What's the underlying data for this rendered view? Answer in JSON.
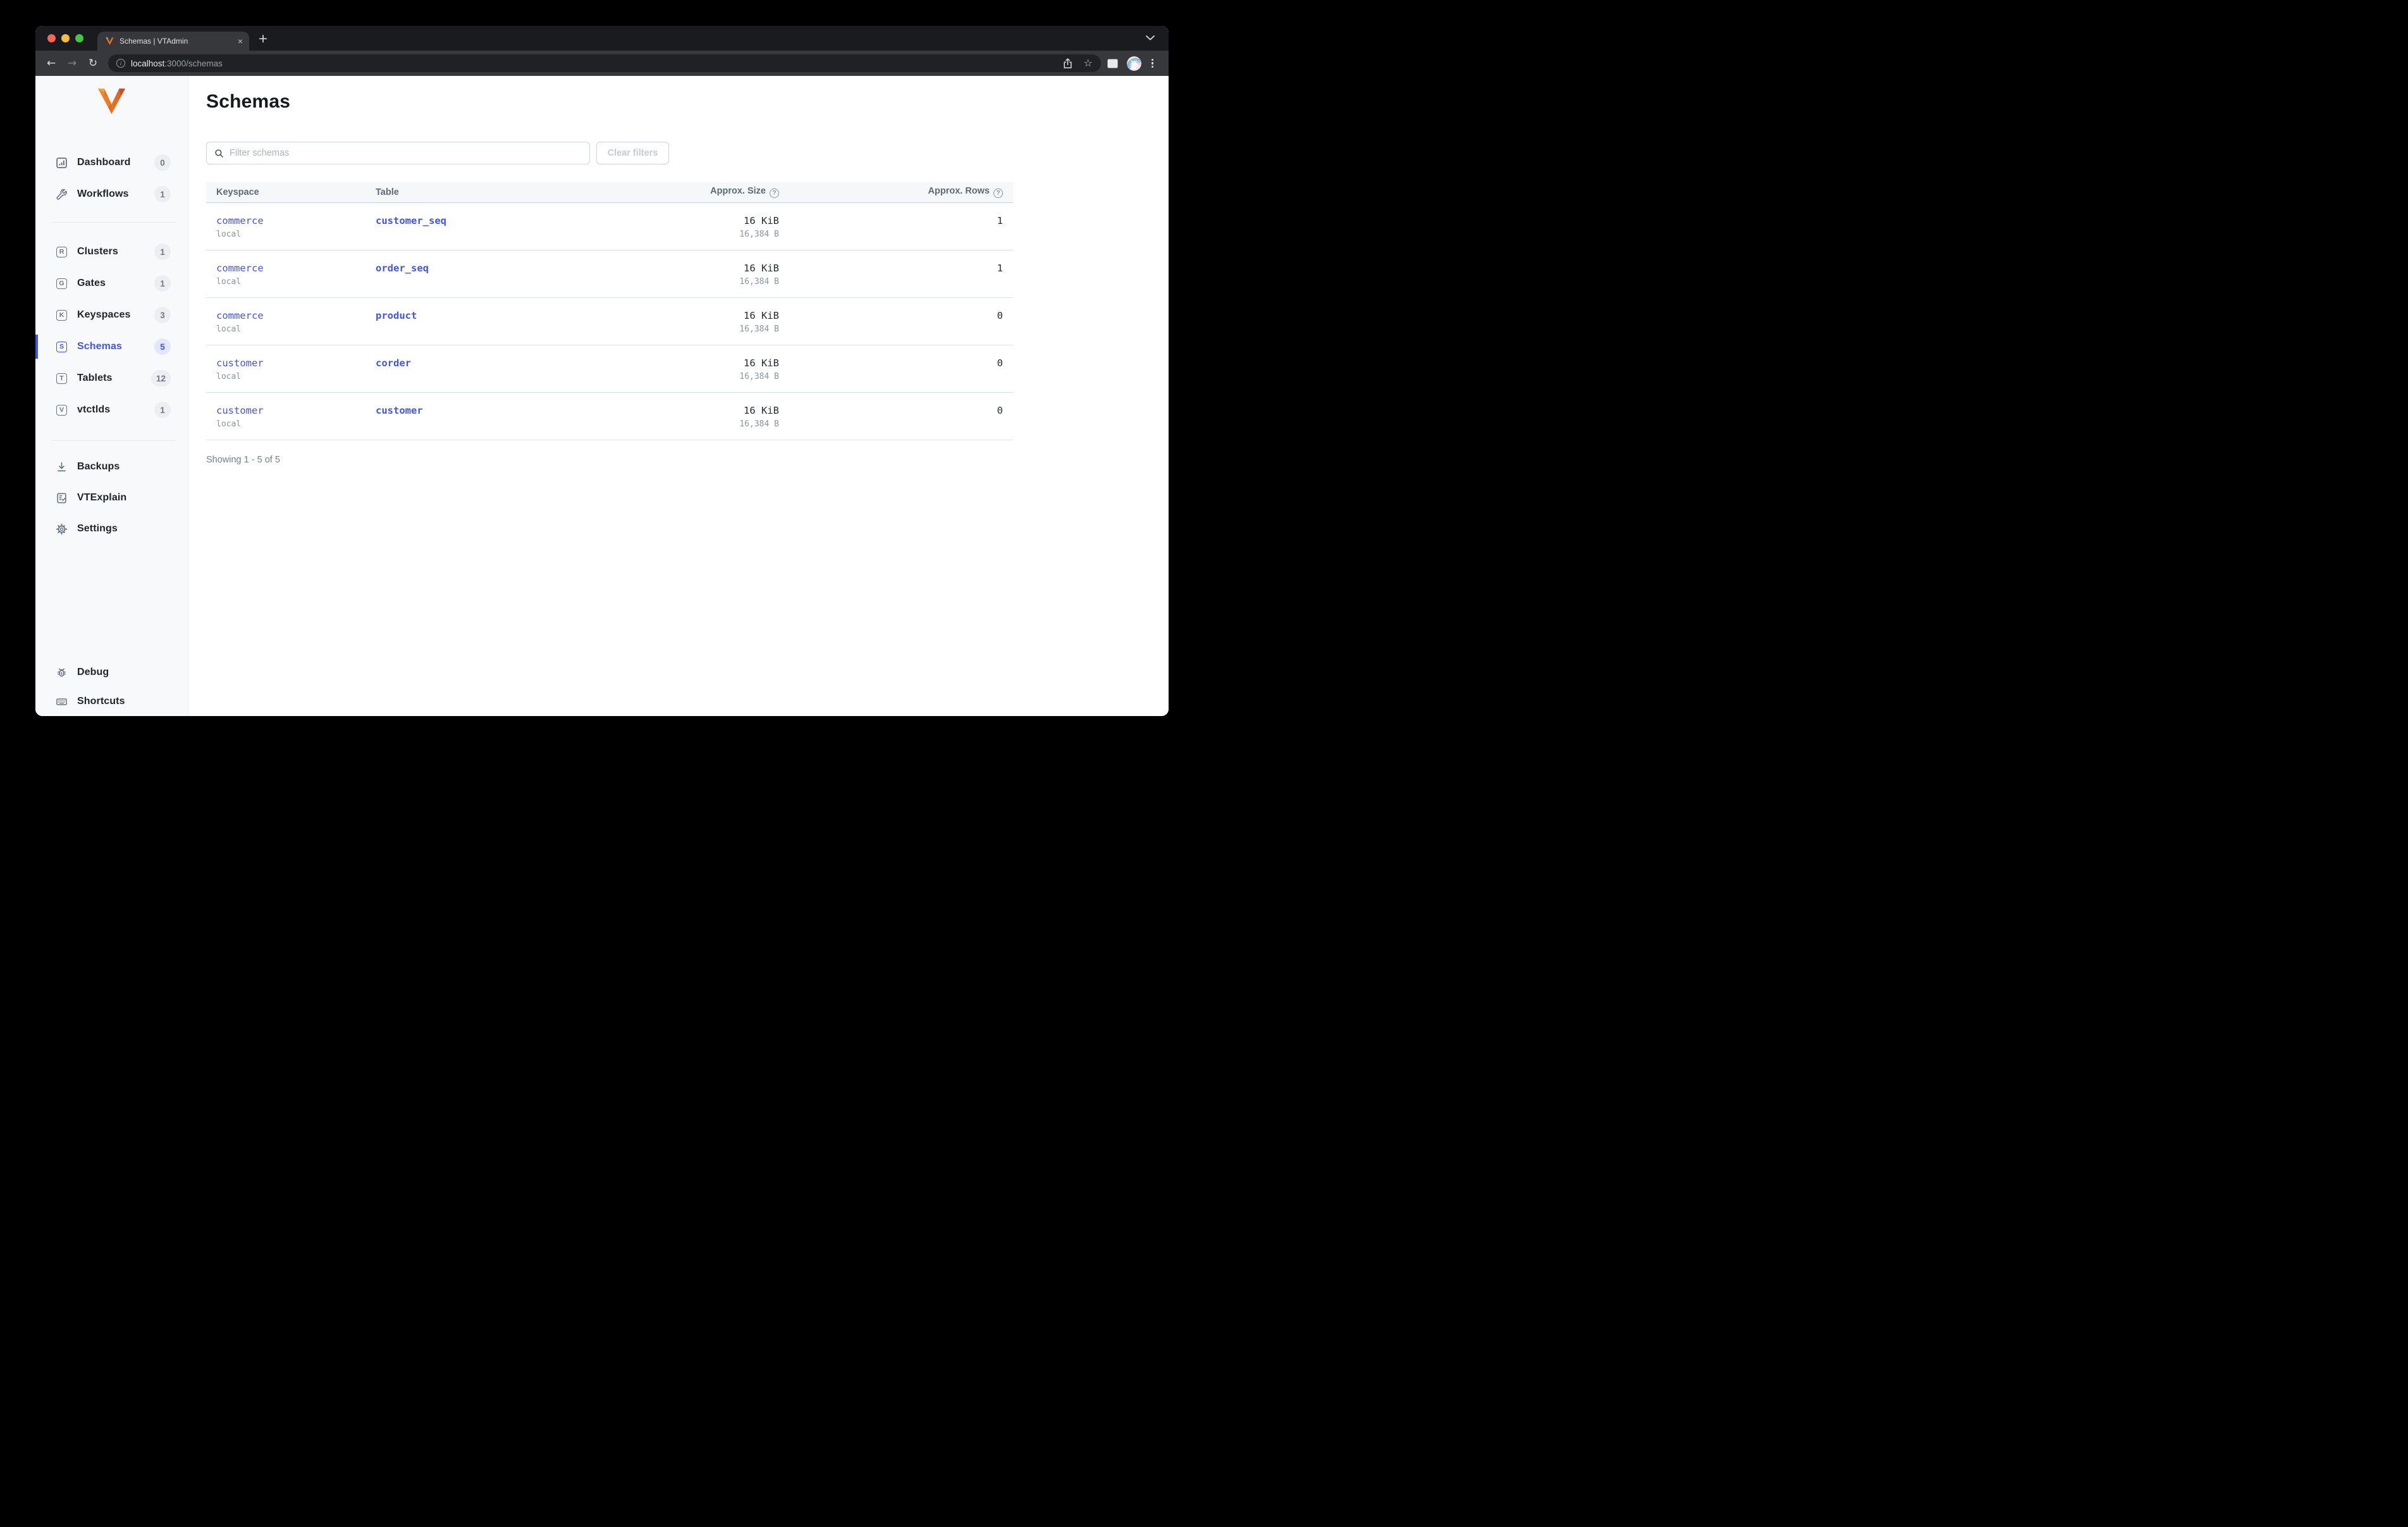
{
  "colors": {
    "accent": "#4154ee"
  },
  "browser": {
    "tab_title": "Schemas | VTAdmin",
    "close_glyph": "×",
    "new_tab_glyph": "+",
    "back_glyph": "←",
    "forward_glyph": "→",
    "reload_glyph": "↻",
    "info_glyph": "i",
    "star_glyph": "☆",
    "url_host": "localhost",
    "url_path": ":3000/schemas"
  },
  "sidebar": {
    "items": [
      {
        "label": "Dashboard",
        "badge": "0"
      },
      {
        "label": "Workflows",
        "badge": "1"
      },
      {
        "label": "Clusters",
        "badge": "1",
        "letter": "R"
      },
      {
        "label": "Gates",
        "badge": "1",
        "letter": "G"
      },
      {
        "label": "Keyspaces",
        "badge": "3",
        "letter": "K"
      },
      {
        "label": "Schemas",
        "badge": "5",
        "letter": "S",
        "active": true
      },
      {
        "label": "Tablets",
        "badge": "12",
        "letter": "T"
      },
      {
        "label": "vtctlds",
        "badge": "1",
        "letter": "V"
      },
      {
        "label": "Backups"
      },
      {
        "label": "VTExplain"
      },
      {
        "label": "Settings"
      },
      {
        "label": "Debug"
      },
      {
        "label": "Shortcuts"
      }
    ]
  },
  "main": {
    "title": "Schemas",
    "filter": {
      "placeholder": "Filter schemas",
      "clear_label": "Clear filters"
    },
    "table": {
      "columns": {
        "keyspace": "Keyspace",
        "table": "Table",
        "size": "Approx. Size",
        "rows": "Approx. Rows"
      },
      "help_glyph": "?",
      "rows": [
        {
          "keyspace": "commerce",
          "cluster": "local",
          "table": "customer_seq",
          "size": "16 KiB",
          "size_bytes": "16,384 B",
          "rows": "1"
        },
        {
          "keyspace": "commerce",
          "cluster": "local",
          "table": "order_seq",
          "size": "16 KiB",
          "size_bytes": "16,384 B",
          "rows": "1"
        },
        {
          "keyspace": "commerce",
          "cluster": "local",
          "table": "product",
          "size": "16 KiB",
          "size_bytes": "16,384 B",
          "rows": "0"
        },
        {
          "keyspace": "customer",
          "cluster": "local",
          "table": "corder",
          "size": "16 KiB",
          "size_bytes": "16,384 B",
          "rows": "0"
        },
        {
          "keyspace": "customer",
          "cluster": "local",
          "table": "customer",
          "size": "16 KiB",
          "size_bytes": "16,384 B",
          "rows": "0"
        }
      ],
      "footer": "Showing 1 - 5 of 5"
    }
  }
}
